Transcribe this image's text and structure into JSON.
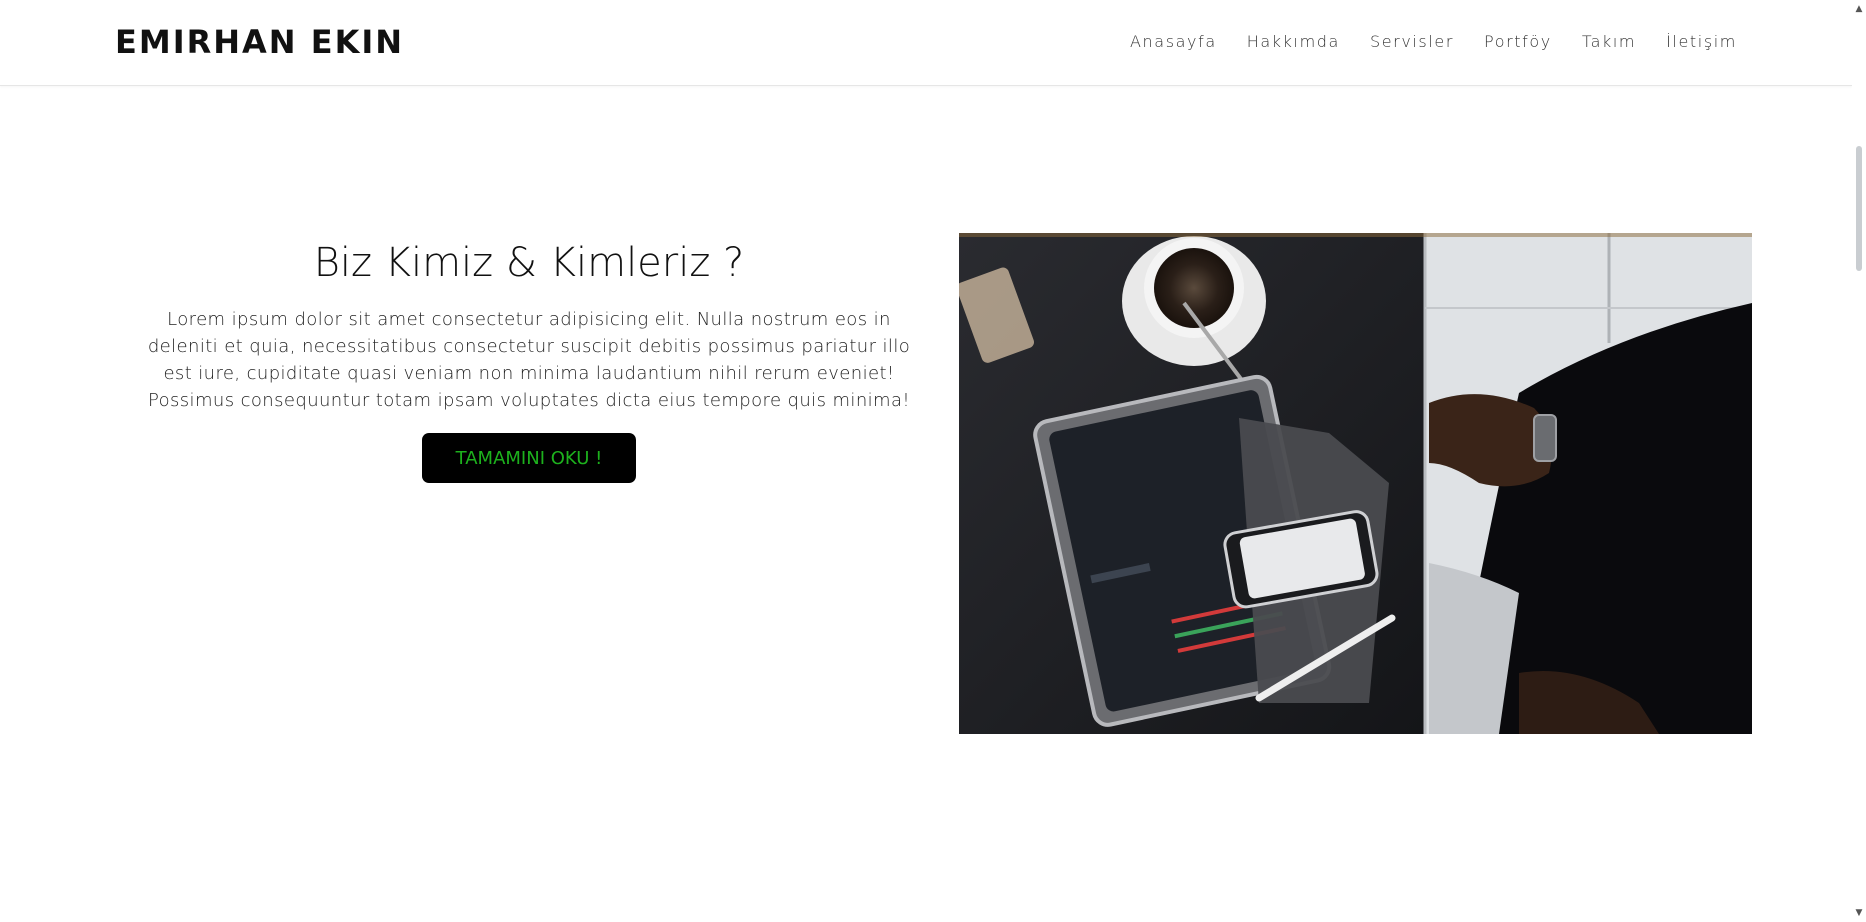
{
  "navbar": {
    "brand": "EMIRHAN EKIN",
    "links": [
      "Anasayfa",
      "Hakkımda",
      "Servisler",
      "Portföy",
      "Takım",
      "İletişim"
    ]
  },
  "about": {
    "title": "Biz Kimiz & Kimleriz ?",
    "body": "Lorem ipsum dolor sit amet consectetur adipisicing elit. Nulla nostrum eos in deleniti et quia, necessitatibus consectetur suscipit debitis possimus pariatur illo est iure, cupiditate quasi veniam non minima laudantium nihil rerum eveniet! Possimus consequuntur totam ipsam voluptates dicta eius tempore quis minima!",
    "button_label": "TAMAMINI OKU !"
  },
  "colors": {
    "button_bg": "#000000",
    "button_text": "#1db11d"
  },
  "icons": {
    "scroll_up": "chevron-up-icon",
    "scroll_down": "chevron-down-icon"
  }
}
